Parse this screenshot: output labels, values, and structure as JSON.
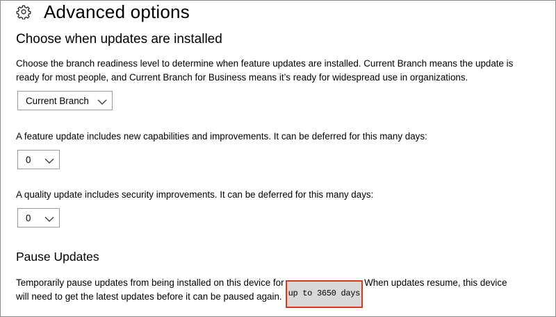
{
  "header": {
    "title": "Advanced options",
    "icon": "gear-icon"
  },
  "branch_section": {
    "heading": "Choose when updates are installed",
    "description_line1": "Choose the branch readiness level to determine when feature updates are installed. Current Branch means the update is",
    "description_line2": "ready for most people, and Current Branch for Business means it’s ready for widespread use in organizations.",
    "dropdown_value": "Current Branch"
  },
  "feature_section": {
    "description": "A feature update includes new capabilities and improvements. It can be deferred for this many days:",
    "dropdown_value": "0"
  },
  "quality_section": {
    "description": "A quality update includes security improvements. It can be deferred for this many days:",
    "dropdown_value": "0"
  },
  "pause_section": {
    "heading": "Pause Updates",
    "text_before": "Temporarily pause updates from being installed on this device for",
    "highlight": "up to 3650 days",
    "text_after": "When updates resume, this device",
    "line2": "will need to get the latest updates before it can be paused again."
  },
  "colors": {
    "highlight_border": "#d9361c",
    "highlight_fill": "#d8d8d8",
    "dropdown_border": "#999999"
  }
}
